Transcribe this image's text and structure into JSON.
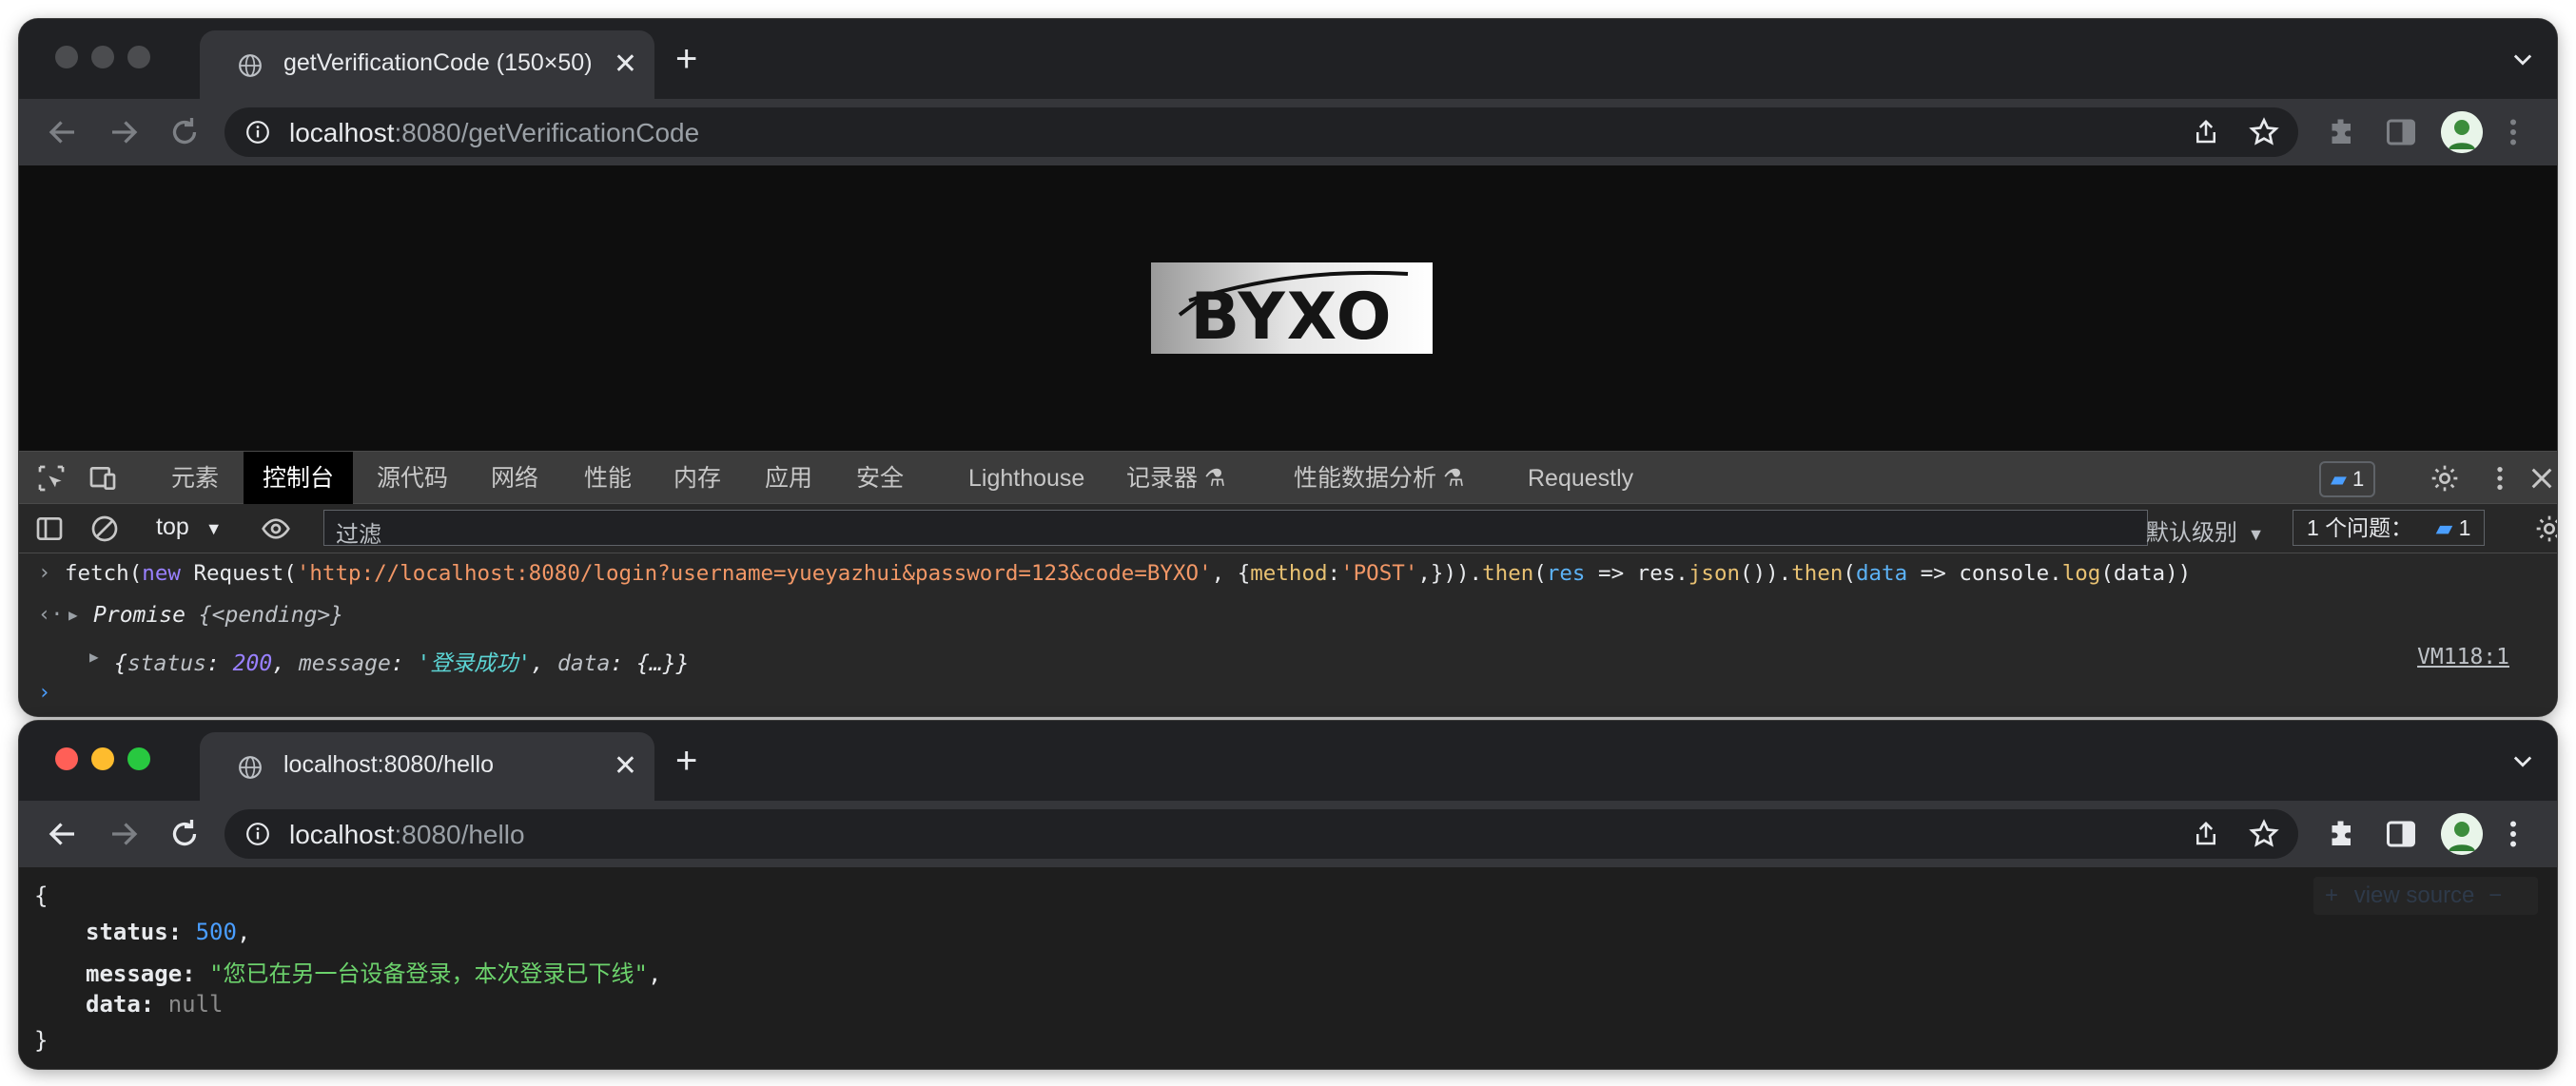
{
  "window1": {
    "tab_title": "getVerificationCode (150×50)",
    "url_host": "localhost",
    "url_rest": ":8080/getVerificationCode",
    "captcha_text": "BYXO"
  },
  "devtools": {
    "tabs": [
      "元素",
      "控制台",
      "源代码",
      "网络",
      "性能",
      "内存",
      "应用",
      "安全",
      "Lighthouse",
      "记录器",
      "性能数据分析",
      "Requestly"
    ],
    "active_tab": "控制台",
    "badge_count": "1",
    "context": "top",
    "filter_placeholder": "过滤",
    "levels": "默认级别",
    "issues_label": "1 个问题：",
    "issues_count": "1",
    "console": {
      "cmd": {
        "p1": "fetch(",
        "kw_new": "new",
        "p2": " Request(",
        "url": "'http://localhost:8080/login?username=yueyazhui&password=123&code=BYXO'",
        "p3": ", {",
        "method_key": "method",
        "p4": ":",
        "method_val": "'POST'",
        "p5": ",})).",
        "then1": "then",
        "p6": "(",
        "res": "res",
        "p7": " => res.",
        "json": "json",
        "p8": "()).",
        "then2": "then",
        "p9": "(",
        "data": "data",
        "p10": " => console.",
        "log": "log",
        "p11": "(data))"
      },
      "promise_label": "Promise",
      "promise_state": "{<pending>}",
      "result": {
        "status_key": "status",
        "status_val": "200",
        "message_key": "message",
        "message_val": "'登录成功'",
        "data_key": "data",
        "data_val": "{…}"
      },
      "source_link": "VM118:1"
    }
  },
  "window2": {
    "tab_title": "localhost:8080/hello",
    "url_host": "localhost",
    "url_rest": ":8080/hello",
    "view_source": "view source",
    "json": {
      "open": "{",
      "status_key": "status",
      "status_val": "500",
      "message_key": "message",
      "message_val": "\"您已在另一台设备登录，本次登录已下线\"",
      "data_key": "data",
      "data_val": "null",
      "close": "}"
    }
  },
  "colors": {
    "traffic_red": "#ff5f57",
    "traffic_yellow": "#febc2e",
    "traffic_green": "#28c840",
    "inactive_light": "#4b4c4f"
  }
}
